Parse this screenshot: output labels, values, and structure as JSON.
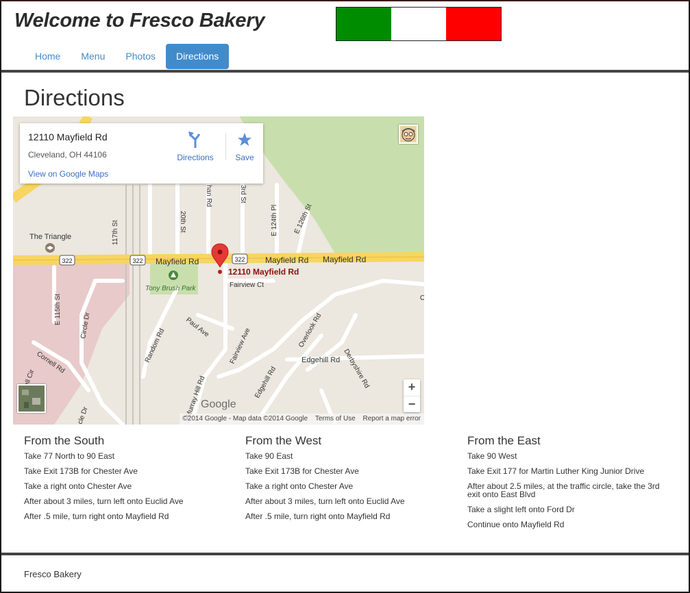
{
  "header": {
    "title": "Welcome to Fresco Bakery",
    "flag_colors": [
      "#008c00",
      "#ffffff",
      "#ff0000"
    ]
  },
  "nav": [
    {
      "label": "Home",
      "active": false
    },
    {
      "label": "Menu",
      "active": false
    },
    {
      "label": "Photos",
      "active": false
    },
    {
      "label": "Directions",
      "active": true
    }
  ],
  "page": {
    "heading": "Directions"
  },
  "map": {
    "card": {
      "address_line1": "12110 Mayfield Rd",
      "address_line2": "Cleveland, OH 44106",
      "view_link": "View on Google Maps",
      "directions_label": "Directions",
      "save_label": "Save"
    },
    "labels": {
      "triangle": "The Triangle",
      "park": "Tony Brush Park",
      "mayfield_1": "Mayfield Rd",
      "mayfield_2": "Mayfield Rd",
      "mayfield_3": "Mayfield Rd",
      "marker": "12110 Mayfield Rd",
      "fairview_ct": "Fairview Ct",
      "edgehill": "Edgehill Rd",
      "e115": "E 115th St",
      "circle_dr": "Circle Dr",
      "cornell": "Cornell Rd",
      "random": "Random Rd",
      "paul_ave": "Paul Ave",
      "fairview_ave": "Fairview Ave",
      "overlook": "Overlook Rd",
      "derbyshire": "Derbyshire Rd",
      "murray": "Murray Hill Rd",
      "edgehill_2": "Edgehill Rd",
      "e124": "E 124th Pl",
      "e126": "E 126th St",
      "e117": "117th St",
      "e120": "20th St",
      "e123": "3rd St",
      "han": "han Rd",
      "cell": "ell Cir",
      "cle": "cle Dr",
      "o_edge": "O",
      "us322": "322"
    },
    "zoom_in": "+",
    "zoom_out": "−",
    "logo": "Google",
    "footer": {
      "copyright": "©2014 Google - Map data ©2014 Google",
      "terms": "Terms of Use",
      "report": "Report a map error"
    },
    "colors": {
      "land": "#ece7df",
      "highway": "#f7d560",
      "park": "#c8dfad",
      "campus": "#e8caca",
      "marker": "#e53935"
    }
  },
  "directions": {
    "south": {
      "heading": "From the South",
      "steps": [
        "Take 77 North to 90 East",
        "Take Exit 173B for Chester Ave",
        "Take a right onto Chester Ave",
        "After about 3 miles, turn left onto Euclid Ave",
        "After .5 mile, turn right onto Mayfield Rd"
      ]
    },
    "west": {
      "heading": "From the West",
      "steps": [
        "Take 90 East",
        "Take Exit 173B for Chester Ave",
        "Take a right onto Chester Ave",
        "After about 3 miles, turn left onto Euclid Ave",
        "After .5 mile, turn right onto Mayfield Rd"
      ]
    },
    "east": {
      "heading": "From the East",
      "steps": [
        "Take 90 West",
        "Take Exit 177 for Martin Luther King Junior Drive",
        "After about 2.5 miles, at the traffic circle, take the 3rd exit onto East Blvd",
        "Take a slight left onto Ford Dr",
        "Continue onto Mayfield Rd"
      ]
    }
  },
  "footer": {
    "text": "Fresco Bakery"
  }
}
